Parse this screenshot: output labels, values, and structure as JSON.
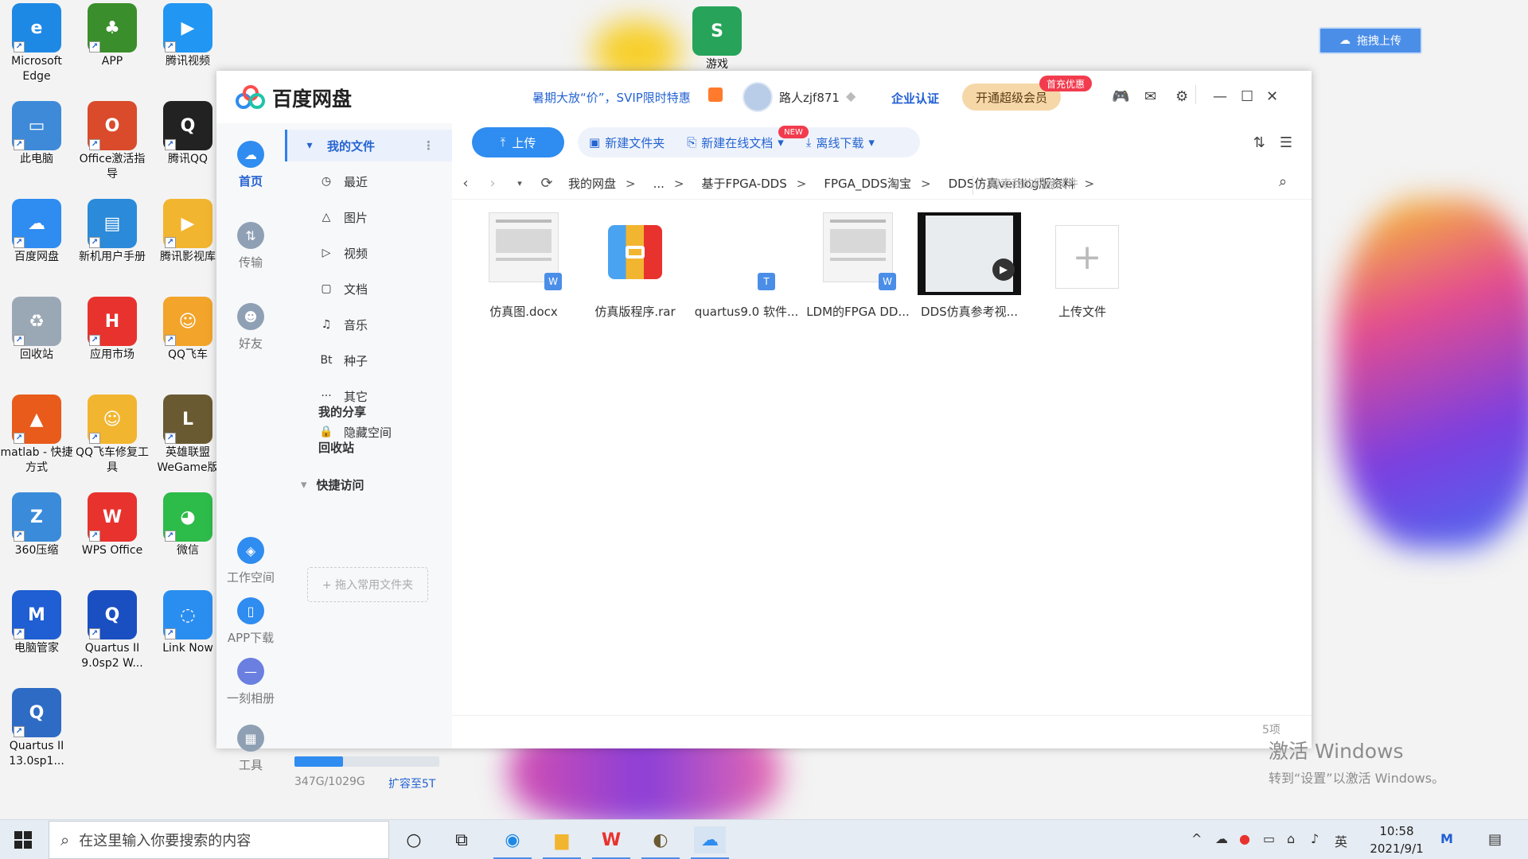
{
  "desktop": {
    "icons": [
      {
        "label": "Microsoft Edge",
        "icon": "edge-icon",
        "color": "#1e88e5"
      },
      {
        "label": "APP",
        "icon": "tree-icon",
        "color": "#3a8e2b"
      },
      {
        "label": "腾讯视频",
        "icon": "tencent-video-icon",
        "color": "#2196f3"
      },
      {
        "label": "此电脑",
        "icon": "computer-icon",
        "color": "#3e8ad9"
      },
      {
        "label": "Office激活指导",
        "icon": "office-icon",
        "color": "#d94b2b"
      },
      {
        "label": "腾讯QQ",
        "icon": "qq-icon",
        "color": "#222222"
      },
      {
        "label": "百度网盘",
        "icon": "baidu-netdisk-icon",
        "color": "#2f8cf0"
      },
      {
        "label": "新机用户手册",
        "icon": "manual-icon",
        "color": "#2b8ad9"
      },
      {
        "label": "腾讯影视库",
        "icon": "folder-video-icon",
        "color": "#f2b530"
      },
      {
        "label": "回收站",
        "icon": "recycle-bin-icon",
        "color": "#9aa7b5"
      },
      {
        "label": "应用市场",
        "icon": "huawei-appstore-icon",
        "color": "#e8322e"
      },
      {
        "label": "QQ飞车",
        "icon": "qq-speed-icon",
        "color": "#f2a42b"
      },
      {
        "label": "matlab - 快捷方式",
        "icon": "matlab-icon",
        "color": "#e85b1a"
      },
      {
        "label": "QQ飞车修复工具",
        "icon": "qq-speed-repair-icon",
        "color": "#f2b530"
      },
      {
        "label": "英雄联盟WeGame版",
        "icon": "lol-icon",
        "color": "#6a5a32"
      },
      {
        "label": "360压缩",
        "icon": "360-zip-icon",
        "color": "#3a8bd9"
      },
      {
        "label": "WPS Office",
        "icon": "wps-icon",
        "color": "#e8322e"
      },
      {
        "label": "微信",
        "icon": "wechat-icon",
        "color": "#2dbb4a"
      },
      {
        "label": "电脑管家",
        "icon": "pc-manager-icon",
        "color": "#1f5ed3"
      },
      {
        "label": "Quartus II 9.0sp2 W...",
        "icon": "quartus-icon",
        "color": "#1a4fc2"
      },
      {
        "label": "Link Now",
        "icon": "link-now-icon",
        "color": "#2a8ef0"
      },
      {
        "label": "Quartus II 13.0sp1...",
        "icon": "quartus-icon",
        "color": "#2e6bc4"
      },
      {
        "label": "游戏",
        "icon": "spreadsheet-file-icon",
        "color": "#27a35a"
      }
    ],
    "float_upload": "拖拽上传",
    "activation_title": "激活 Windows",
    "activation_sub": "转到“设置”以激活 Windows。"
  },
  "app": {
    "title": "百度网盘",
    "promo": "暑期大放“价”，SVIP限时特惠",
    "username": "路人zjf871",
    "enterprise": "企业认证",
    "vip_button": "开通超级会员",
    "vip_tag": "首充优惠",
    "accent": "#2f8cf0"
  },
  "nav": [
    {
      "label": "首页",
      "icon": "home-cloud-icon",
      "active": true
    },
    {
      "label": "传输",
      "icon": "transfer-icon"
    },
    {
      "label": "好友",
      "icon": "friends-icon"
    },
    {
      "label": "工作空间",
      "icon": "workspace-icon"
    },
    {
      "label": "APP下载",
      "icon": "app-download-icon"
    },
    {
      "label": "一刻相册",
      "icon": "album-icon"
    },
    {
      "label": "工具",
      "icon": "tools-icon"
    }
  ],
  "sidebar": {
    "my_files": "我的文件",
    "items": [
      {
        "label": "最近",
        "icon": "clock-icon"
      },
      {
        "label": "图片",
        "icon": "image-icon"
      },
      {
        "label": "视频",
        "icon": "video-icon"
      },
      {
        "label": "文档",
        "icon": "document-icon"
      },
      {
        "label": "音乐",
        "icon": "music-icon"
      },
      {
        "label": "种子",
        "icon": "torrent-icon"
      },
      {
        "label": "其它",
        "icon": "more-icon"
      },
      {
        "label": "隐藏空间",
        "icon": "lock-icon"
      }
    ],
    "my_share": "我的分享",
    "recycle": "回收站",
    "quick_access": "快捷访问",
    "drop_hint": "+ 拖入常用文件夹",
    "storage_text": "347G/1029G",
    "storage_fraction": 0.337,
    "expand": "扩容至5T"
  },
  "toolbar": {
    "upload": "上传",
    "new_folder": "新建文件夹",
    "new_online_doc": "新建在线文档",
    "new_tag": "NEW",
    "offline_download": "离线下载"
  },
  "path": {
    "crumbs": [
      "我的网盘",
      "...",
      "基于FPGA-DDS",
      "FPGA_DDS淘宝",
      "DDS仿真verilog版资料"
    ],
    "search_placeholder": "搜索我的网盘文件"
  },
  "files": [
    {
      "name": "仿真图.docx",
      "type": "docx"
    },
    {
      "name": "仿真版程序.rar",
      "type": "rar"
    },
    {
      "name": "quartus9.0 软件...",
      "type": "txt"
    },
    {
      "name": "LDM的FPGA DD...",
      "type": "docx"
    },
    {
      "name": "DDS仿真参考视...",
      "type": "video"
    },
    {
      "name": "上传文件",
      "type": "upload"
    }
  ],
  "item_count": "5项",
  "taskbar": {
    "search_placeholder": "在这里输入你要搜索的内容",
    "ime": "英",
    "time": "10:58",
    "date": "2021/9/1"
  }
}
